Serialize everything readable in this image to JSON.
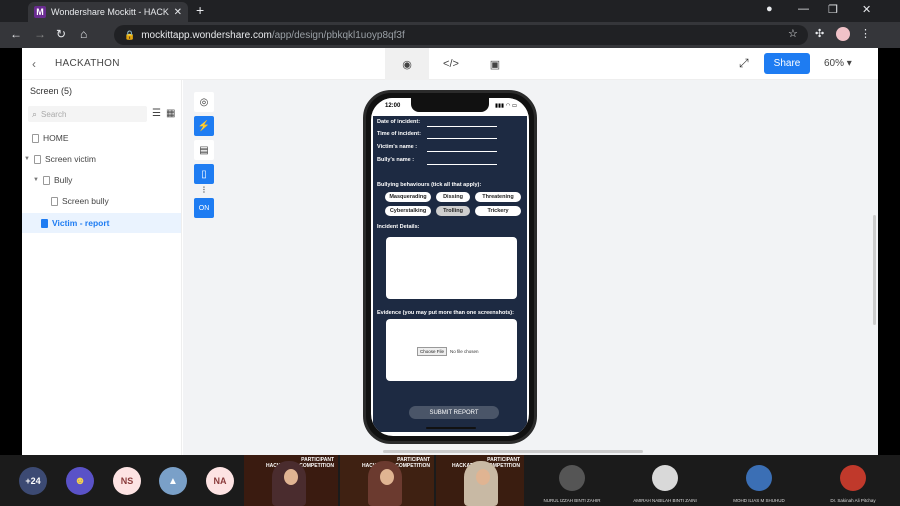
{
  "browser": {
    "tab_favicon": "M",
    "tab_title": "Wondershare Mockitt - HACKATH",
    "url_host": "mockittapp.wondershare.com",
    "url_path": "/app/design/pbkqkl1uoyp8qf3f"
  },
  "header": {
    "project_name": "HACKATHON",
    "share_label": "Share",
    "zoom_label": "60%"
  },
  "left_panel": {
    "screen_count_label": "Screen  (5)",
    "search_placeholder": "Search",
    "tree": [
      {
        "label": "HOME"
      },
      {
        "label": "Screen victim"
      },
      {
        "label": "Bully"
      },
      {
        "label": "Screen bully"
      },
      {
        "label": "Victim - report"
      }
    ]
  },
  "toolbar": {
    "screen_tool_label": "ON"
  },
  "phone": {
    "status_time": "12:00",
    "status_icons": "▮▮▮ ◠ ▭",
    "form": {
      "date_label": "Date of incident:",
      "time_label": "Time of incident:",
      "victim_label": "Victim's name     :",
      "bully_label": "Bully's  name    :",
      "behaviours_label": "Bullying behaviours (tick all that apply):",
      "behaviours": [
        "Masquerading",
        "Dissing",
        "Threatening",
        "Cyberstalking",
        "Trolling",
        "Trickery"
      ],
      "details_label": "Incident Details:",
      "evidence_label": "Evidence (you may put more than one screenshots):",
      "choose_file": "Choose File",
      "no_file": "No file chosen",
      "submit_label": "SUBMIT REPORT"
    }
  },
  "call": {
    "overflow_count": "+24",
    "initials": [
      "NS",
      "NA"
    ],
    "banner_title": "PARTICIPANT",
    "banner_sub": "HACKATHON COMPETITION",
    "participants": [
      "NURUL IZZAH BINTI ZAHIR",
      "AMIRAH NABILAH BINTI ZAINI",
      "MOHD ILIAS M SHUHUD",
      "Dr. Sakinah Ali Pitchay"
    ]
  },
  "colors": {
    "accent": "#1e7cf2",
    "form_bg": "#1d2a42",
    "browser_dark": "#202124"
  }
}
